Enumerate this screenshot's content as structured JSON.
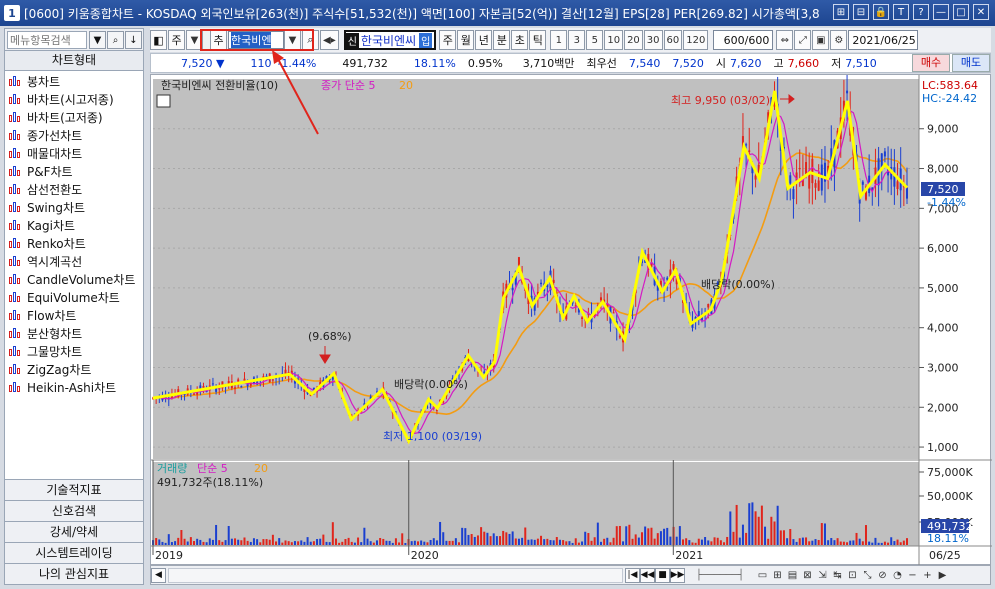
{
  "window": {
    "num": "1",
    "title": "[0600] 키움종합차트 - KOSDAQ 외국인보유[263(천)] 주식수[51,532(천)] 액면[100] 자본금[52(억)] 결산[12월] EPS[28] PER[269.82] 시가총액[3,8",
    "icons": [
      "⊞",
      "⊟",
      "🔒",
      "T",
      "?",
      "—",
      "□",
      "✕"
    ]
  },
  "sidebar": {
    "search_placeholder": "메뉴항목검색",
    "header": "차트형태",
    "items": [
      "봉차트",
      "바차트(시고저종)",
      "바차트(고저종)",
      "종가선차트",
      "매물대차트",
      "P&F차트",
      "삼선전환도",
      "Swing차트",
      "Kagi차트",
      "Renko차트",
      "역시계곡선",
      "CandleVolume차트",
      "EquiVolume차트",
      "Flow차트",
      "분산형차트",
      "그물망차트",
      "ZigZag차트",
      "Heikin-Ashi차트"
    ],
    "bottom": [
      "기술적지표",
      "신호검색",
      "강세/약세",
      "시스템트레이딩",
      "나의 관심지표"
    ]
  },
  "toolbar": {
    "view_btn": "◧",
    "type_label": "주",
    "recommend_label": "추",
    "code_value": "한국비엔",
    "name_prefix": "신",
    "stock_name": "한국비엔씨",
    "status": "입",
    "periods": [
      "주",
      "월",
      "년",
      "분",
      "초",
      "틱"
    ],
    "minute_options": [
      "1",
      "3",
      "5",
      "10",
      "20",
      "30",
      "60",
      "120"
    ],
    "count_value": "600/600",
    "date_value": "2021/06/25"
  },
  "pricebar": {
    "price": "7,520 ▼",
    "change": "110",
    "change_pct": "-1.44%",
    "volume": "491,732",
    "vol_pct": "18.11%",
    "turnover": "0.95%",
    "amount": "3,710백만",
    "best_label": "최우선",
    "best_sell": "7,540",
    "best_buy": "7,520",
    "open_label": "시",
    "open": "7,620",
    "high_label": "고",
    "high": "7,660",
    "low_label": "저",
    "low": "7,510",
    "buy_btn": "매수",
    "sell_btn": "매도"
  },
  "chart": {
    "legend_name": "한국비엔씨 전환비율(10)",
    "legend_ma": "종가 단순 5",
    "legend_ma2": "20",
    "lc": "LC:583.64",
    "hc": "HC:-24.42",
    "price_tag": "7,520",
    "price_tag_pct": "-1.44%",
    "ann_high": "최고 9,950 (03/02)",
    "ann_low": "최저 1,100 (03/19)",
    "ann_div1": "배당락(0.00%)",
    "ann_div2": "배당락(0.00%)",
    "ann_pct": "(9.68%)",
    "vol_legend_name": "거래량",
    "vol_legend_ma": "단순 5",
    "vol_legend_ma2": "20",
    "vol_value": "491,732주(18.11%)",
    "vol_tag": "491,732",
    "vol_tag_pct": "18.11%",
    "date_tag": "06/25"
  },
  "chart_data": {
    "type": "line",
    "y_ticks": [
      "9,000",
      "8,000",
      "7,000",
      "6,000",
      "5,000",
      "4,000",
      "3,000",
      "2,000",
      "1,000"
    ],
    "vol_ticks": [
      "75,000K",
      "50,000K",
      "25,000K"
    ],
    "x_labels": [
      "2019",
      "2020",
      "2021"
    ],
    "ylim": [
      700,
      10200
    ],
    "zigzag": [
      {
        "x": 0.0,
        "y": 2230
      },
      {
        "x": 0.31,
        "y": 2830
      },
      {
        "x": 0.36,
        "y": 2330
      },
      {
        "x": 0.41,
        "y": 2850
      },
      {
        "x": 0.45,
        "y": 1700
      },
      {
        "x": 0.52,
        "y": 2450
      },
      {
        "x": 0.58,
        "y": 1150
      },
      {
        "x": 0.625,
        "y": 2200
      },
      {
        "x": 0.645,
        "y": 1980
      },
      {
        "x": 0.715,
        "y": 3300
      },
      {
        "x": 0.75,
        "y": 2750
      },
      {
        "x": 0.775,
        "y": 3150
      },
      {
        "x": 0.795,
        "y": 4750
      },
      {
        "x": 0.83,
        "y": 5500
      },
      {
        "x": 0.86,
        "y": 4550
      },
      {
        "x": 0.9,
        "y": 5250
      },
      {
        "x": 0.93,
        "y": 4250
      },
      {
        "x": 0.955,
        "y": 4800
      },
      {
        "x": 0.985,
        "y": 4150
      },
      {
        "x": 1.02,
        "y": 4650
      },
      {
        "x": 1.07,
        "y": 3700
      },
      {
        "x": 1.11,
        "y": 5900
      },
      {
        "x": 1.155,
        "y": 4900
      },
      {
        "x": 1.185,
        "y": 5450
      },
      {
        "x": 1.22,
        "y": 4100
      },
      {
        "x": 1.265,
        "y": 4450
      },
      {
        "x": 1.29,
        "y": 5200
      },
      {
        "x": 1.34,
        "y": 8550
      },
      {
        "x": 1.375,
        "y": 7750
      },
      {
        "x": 1.41,
        "y": 9950
      },
      {
        "x": 1.44,
        "y": 7500
      },
      {
        "x": 1.49,
        "y": 7900
      },
      {
        "x": 1.53,
        "y": 7750
      },
      {
        "x": 1.575,
        "y": 9700
      },
      {
        "x": 1.605,
        "y": 7300
      },
      {
        "x": 1.66,
        "y": 8100
      },
      {
        "x": 1.71,
        "y": 7520
      }
    ]
  }
}
